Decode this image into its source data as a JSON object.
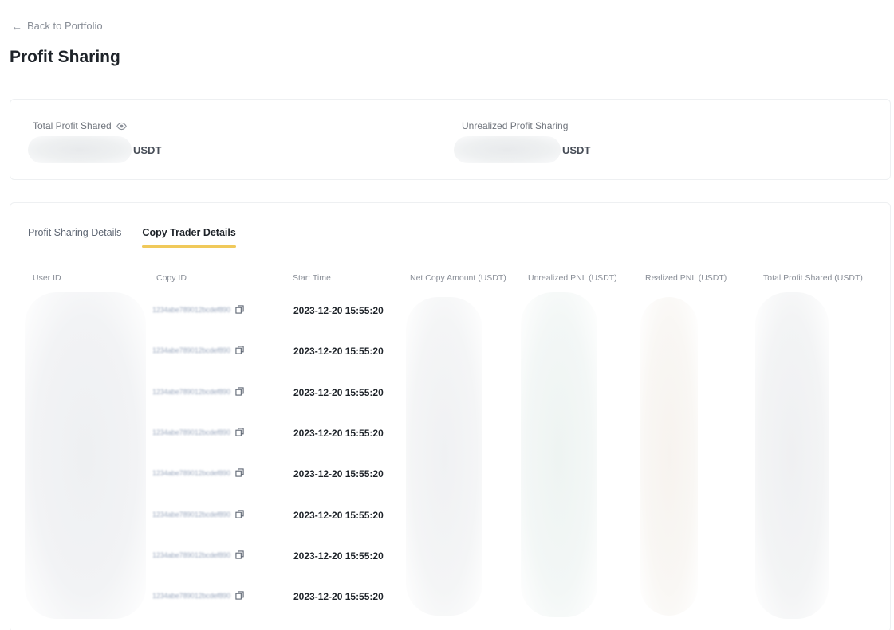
{
  "header": {
    "back_label": "Back to Portfolio",
    "title": "Profit Sharing"
  },
  "summary": {
    "total_profit_shared": {
      "label": "Total Profit Shared",
      "unit": "USDT",
      "icon": "eye-icon"
    },
    "unrealized_profit_sharing": {
      "label": "Unrealized Profit Sharing",
      "unit": "USDT"
    }
  },
  "tabs": [
    {
      "label": "Profit Sharing Details",
      "active": false
    },
    {
      "label": "Copy Trader Details",
      "active": true
    }
  ],
  "table": {
    "columns": [
      "User ID",
      "Copy ID",
      "Start Time",
      "Net Copy Amount (USDT)",
      "Unrealized PNL (USDT)",
      "Realized PNL (USDT)",
      "Total Profit Shared (USDT)"
    ],
    "rows": [
      {
        "copy_id": "1234abe789012bcdef890",
        "start_time": "2023-12-20 15:55:20"
      },
      {
        "copy_id": "1234abe789012bcdef890",
        "start_time": "2023-12-20 15:55:20"
      },
      {
        "copy_id": "1234abe789012bcdef890",
        "start_time": "2023-12-20 15:55:20"
      },
      {
        "copy_id": "1234abe789012bcdef890",
        "start_time": "2023-12-20 15:55:20"
      },
      {
        "copy_id": "1234abe789012bcdef890",
        "start_time": "2023-12-20 15:55:20"
      },
      {
        "copy_id": "1234abe789012bcdef890",
        "start_time": "2023-12-20 15:55:20"
      },
      {
        "copy_id": "1234abe789012bcdef890",
        "start_time": "2023-12-20 15:55:20"
      },
      {
        "copy_id": "1234abe789012bcdef890",
        "start_time": "2023-12-20 15:55:20"
      }
    ]
  },
  "colors": {
    "tab_indicator": "#f0c95a",
    "text_primary": "#1e2329",
    "text_secondary": "#8a8f98"
  }
}
